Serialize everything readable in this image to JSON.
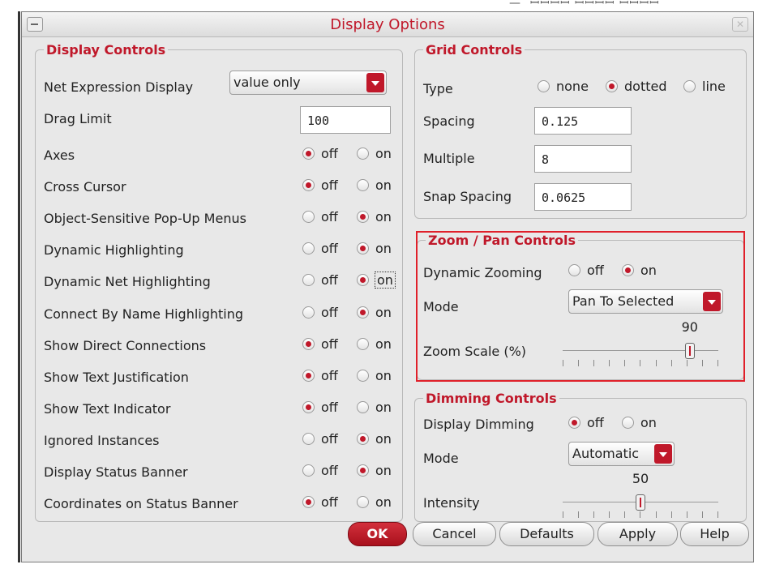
{
  "window": {
    "title": "Display Options"
  },
  "display_controls": {
    "legend": "Display Controls",
    "net_expression": {
      "label": "Net Expression Display",
      "value": "value only"
    },
    "drag_limit": {
      "label": "Drag Limit",
      "value": "100"
    },
    "off_label": "off",
    "on_label": "on",
    "options": [
      {
        "label": "Axes",
        "selected": "off"
      },
      {
        "label": "Cross Cursor",
        "selected": "off"
      },
      {
        "label": "Object-Sensitive Pop-Up Menus",
        "selected": "on"
      },
      {
        "label": "Dynamic Highlighting",
        "selected": "on"
      },
      {
        "label": "Dynamic Net Highlighting",
        "selected": "on"
      },
      {
        "label": "Connect By Name Highlighting",
        "selected": "on"
      },
      {
        "label": "Show Direct Connections",
        "selected": "off"
      },
      {
        "label": "Show Text Justification",
        "selected": "off"
      },
      {
        "label": "Show Text Indicator",
        "selected": "off"
      },
      {
        "label": "Ignored Instances",
        "selected": "on"
      },
      {
        "label": "Display Status Banner",
        "selected": "on"
      },
      {
        "label": "Coordinates on Status Banner",
        "selected": "off"
      }
    ]
  },
  "grid_controls": {
    "legend": "Grid Controls",
    "type": {
      "label": "Type",
      "options": [
        "none",
        "dotted",
        "line"
      ],
      "selected": "dotted"
    },
    "spacing": {
      "label": "Spacing",
      "value": "0.125"
    },
    "multiple": {
      "label": "Multiple",
      "value": "8"
    },
    "snap_spacing": {
      "label": "Snap Spacing",
      "value": "0.0625"
    }
  },
  "zoom_pan_controls": {
    "legend": "Zoom / Pan Controls",
    "dynamic_zooming": {
      "label": "Dynamic Zooming",
      "off_label": "off",
      "on_label": "on",
      "selected": "on"
    },
    "mode": {
      "label": "Mode",
      "value": "Pan To Selected"
    },
    "zoom_scale": {
      "label": "Zoom Scale (%)",
      "value": 90,
      "display": "90"
    }
  },
  "dimming_controls": {
    "legend": "Dimming Controls",
    "display_dimming": {
      "label": "Display Dimming",
      "off_label": "off",
      "on_label": "on",
      "selected": "off"
    },
    "mode": {
      "label": "Mode",
      "value": "Automatic"
    },
    "intensity": {
      "label": "Intensity",
      "value": 50,
      "display": "50"
    }
  },
  "buttons": {
    "ok": {
      "label": "OK",
      "mnemonic": "O"
    },
    "cancel": {
      "label": "Cancel",
      "mnemonic": "C"
    },
    "defaults": {
      "label": "Defaults",
      "mnemonic": "D"
    },
    "apply": {
      "label": "Apply",
      "mnemonic": "A"
    },
    "help": {
      "label": "Help",
      "mnemonic": "H"
    }
  },
  "colors": {
    "accent": "#c0182a",
    "highlight_border": "#e0202a"
  }
}
